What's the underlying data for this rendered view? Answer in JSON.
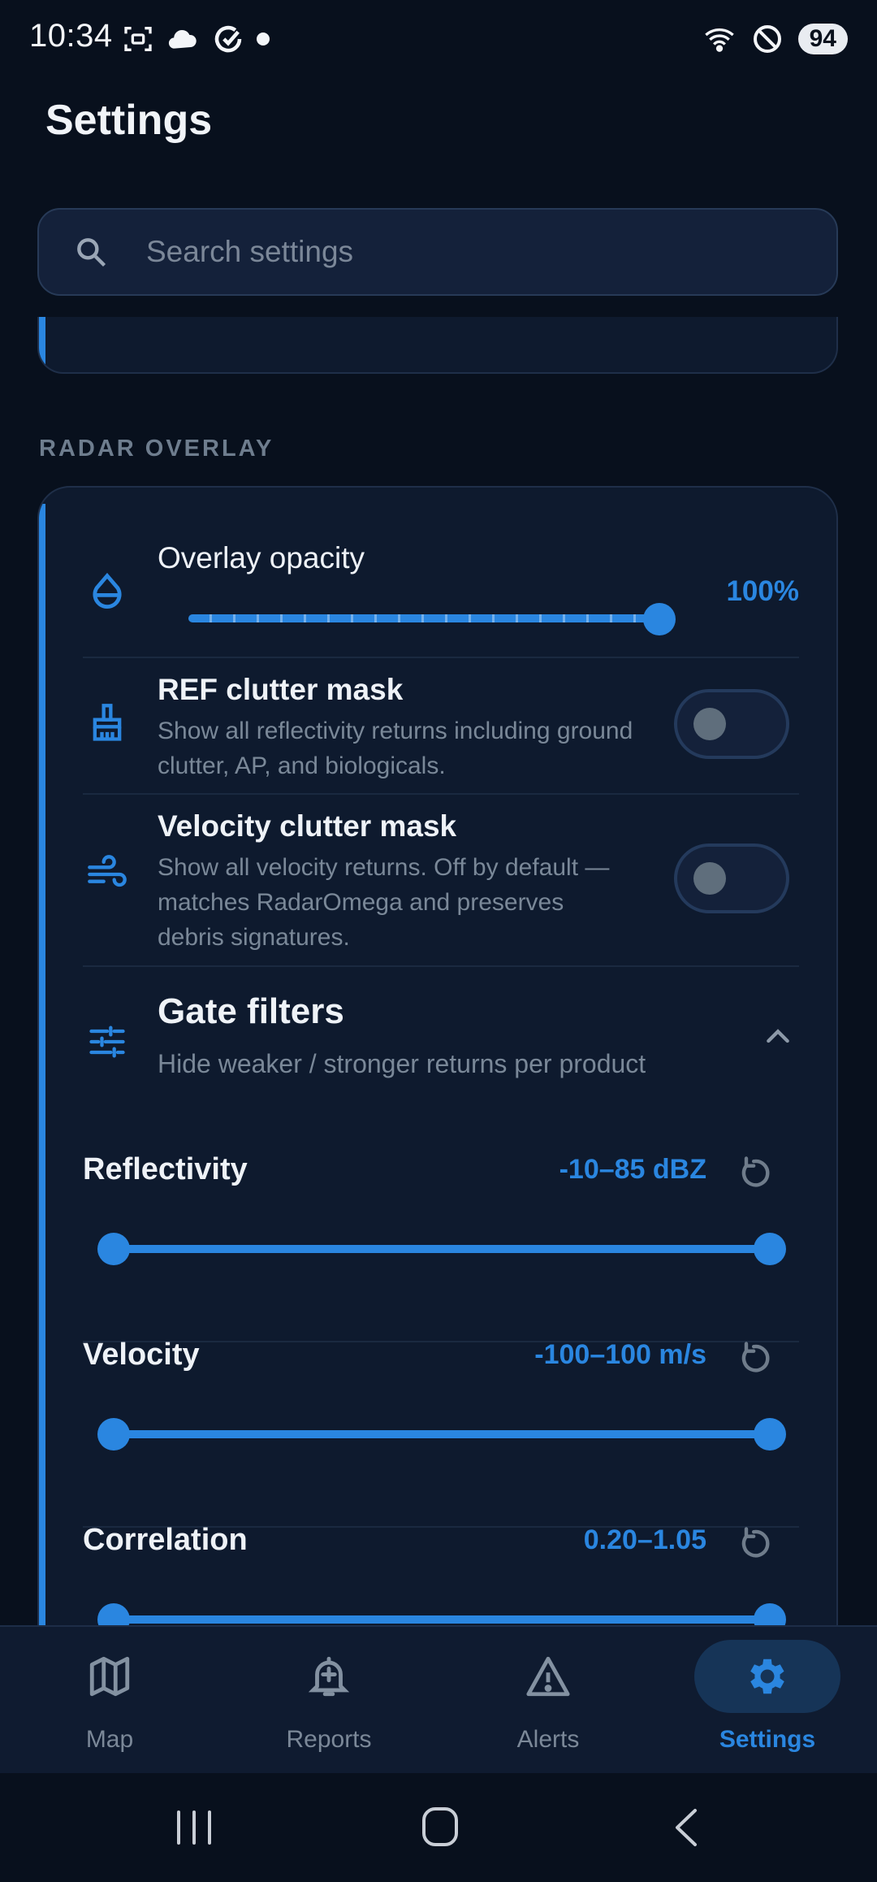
{
  "status_bar": {
    "time": "10:34",
    "battery": "94",
    "left_icons": [
      "screenshot-icon",
      "cloud-icon",
      "sync-icon",
      "dot-icon"
    ],
    "right_icons": [
      "wifi-icon",
      "do-not-disturb-icon",
      "battery-icon"
    ]
  },
  "header": {
    "title": "Settings"
  },
  "search": {
    "placeholder": "Search settings",
    "value": ""
  },
  "section": {
    "label": "RADAR OVERLAY"
  },
  "overlay_opacity": {
    "label": "Overlay opacity",
    "value_text": "100%",
    "value": 1.0,
    "icon": "opacity-drop-icon"
  },
  "ref_clutter": {
    "title": "REF clutter mask",
    "description": "Show all reflectivity returns including ground clutter, AP, and biologicals.",
    "enabled": false,
    "icon": "broom-icon"
  },
  "velocity_clutter": {
    "title": "Velocity clutter mask",
    "description": "Show all velocity returns. Off by default — matches RadarOmega and preserves debris signatures.",
    "enabled": false,
    "icon": "wind-icon"
  },
  "gate_filters": {
    "title": "Gate filters",
    "description": "Hide weaker / stronger returns per product",
    "expanded": true,
    "icon": "tune-sliders-icon",
    "ranges": [
      {
        "label": "Reflectivity",
        "value_text": "-10–85 dBZ",
        "min": -10,
        "max": 85
      },
      {
        "label": "Velocity",
        "value_text": "-100–100 m/s",
        "min": -100,
        "max": 100
      },
      {
        "label": "Correlation",
        "value_text": "0.20–1.05",
        "min": 0.2,
        "max": 1.05
      }
    ]
  },
  "bottom_nav": {
    "items": [
      {
        "label": "Map",
        "icon": "map-icon",
        "active": false
      },
      {
        "label": "Reports",
        "icon": "bell-plus-icon",
        "active": false
      },
      {
        "label": "Alerts",
        "icon": "warning-triangle-icon",
        "active": false
      },
      {
        "label": "Settings",
        "icon": "gear-icon",
        "active": true
      }
    ]
  },
  "colors": {
    "accent": "#2a86e0",
    "background": "#08101d",
    "card": "#0e1a2e",
    "muted_text": "#7a8898"
  }
}
